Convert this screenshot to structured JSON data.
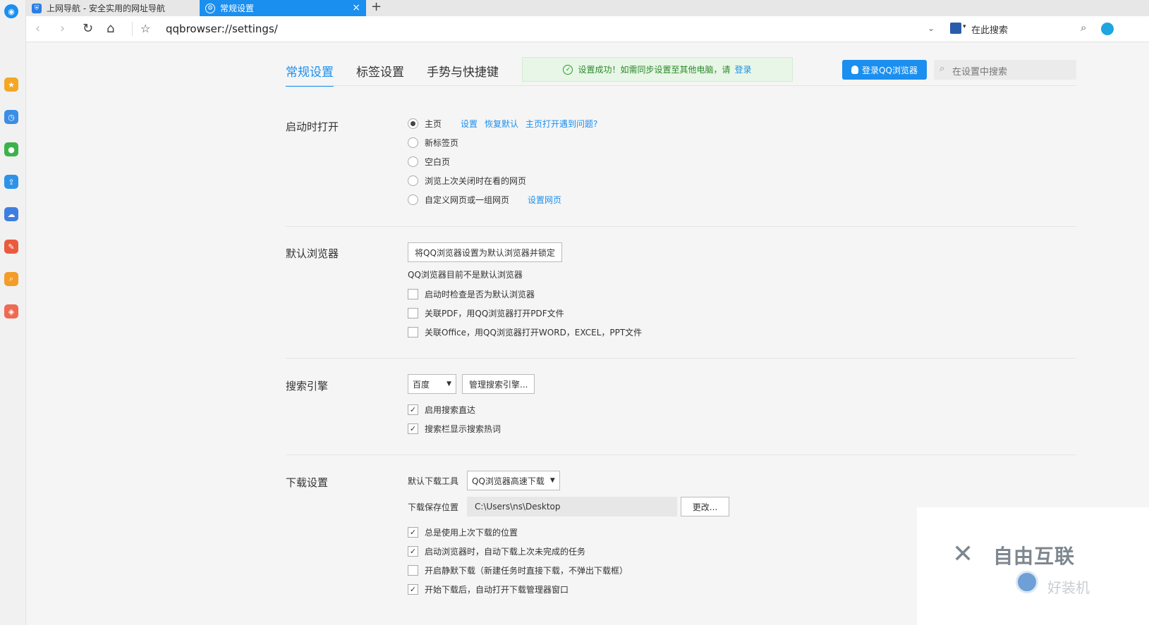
{
  "tabs": [
    {
      "title": "上网导航 - 安全实用的网址导航",
      "icon": "shield-icon"
    },
    {
      "title": "常规设置",
      "icon": "gear-icon",
      "active": true
    }
  ],
  "address": {
    "url": "qqbrowser://settings/"
  },
  "search_engine_box": {
    "placeholder": "在此搜索"
  },
  "settings_nav": [
    "常规设置",
    "标签设置",
    "手势与快捷键"
  ],
  "notice": {
    "text": "设置成功！如需同步设置至其他电脑，请",
    "link": "登录"
  },
  "login_button": "登录QQ浏览器",
  "settings_search_placeholder": "在设置中搜索",
  "startup": {
    "title": "启动时打开",
    "options": [
      {
        "label": "主页",
        "selected": true
      },
      {
        "label": "新标签页",
        "selected": false
      },
      {
        "label": "空白页",
        "selected": false
      },
      {
        "label": "浏览上次关闭时在看的网页",
        "selected": false
      },
      {
        "label": "自定义网页或一组网页",
        "selected": false
      }
    ],
    "home_links": [
      "设置",
      "恢复默认",
      "主页打开遇到问题?"
    ],
    "custom_link": "设置网页"
  },
  "default_browser": {
    "title": "默认浏览器",
    "button": "将QQ浏览器设置为默认浏览器并锁定",
    "status": "QQ浏览器目前不是默认浏览器",
    "checks": [
      {
        "label": "启动时检查是否为默认浏览器",
        "checked": false
      },
      {
        "label": "关联PDF，用QQ浏览器打开PDF文件",
        "checked": false
      },
      {
        "label": "关联Office，用QQ浏览器打开WORD，EXCEL，PPT文件",
        "checked": false
      }
    ]
  },
  "search": {
    "title": "搜索引擎",
    "engine": "百度",
    "manage_button": "管理搜索引擎...",
    "checks": [
      {
        "label": "启用搜索直达",
        "checked": true
      },
      {
        "label": "搜索栏显示搜索热词",
        "checked": true
      }
    ]
  },
  "download": {
    "title": "下载设置",
    "tool_label": "默认下载工具",
    "tool_value": "QQ浏览器高速下载",
    "path_label": "下载保存位置",
    "path_value": "C:\\Users\\ns\\Desktop",
    "change_button": "更改...",
    "checks": [
      {
        "label": "总是使用上次下载的位置",
        "checked": true
      },
      {
        "label": "启动浏览器时，自动下载上次未完成的任务",
        "checked": true
      },
      {
        "label": "开启静默下载（新建任务时直接下载，不弹出下载框）",
        "checked": false
      },
      {
        "label": "开始下载后，自动打开下载管理器窗口",
        "checked": true
      }
    ]
  },
  "watermark": {
    "brand": "自由互联",
    "sub": "好装机"
  },
  "colors": {
    "accent": "#1a8ff0",
    "notice_bg": "#e7f6e6",
    "notice_text": "#2b8a2b"
  }
}
